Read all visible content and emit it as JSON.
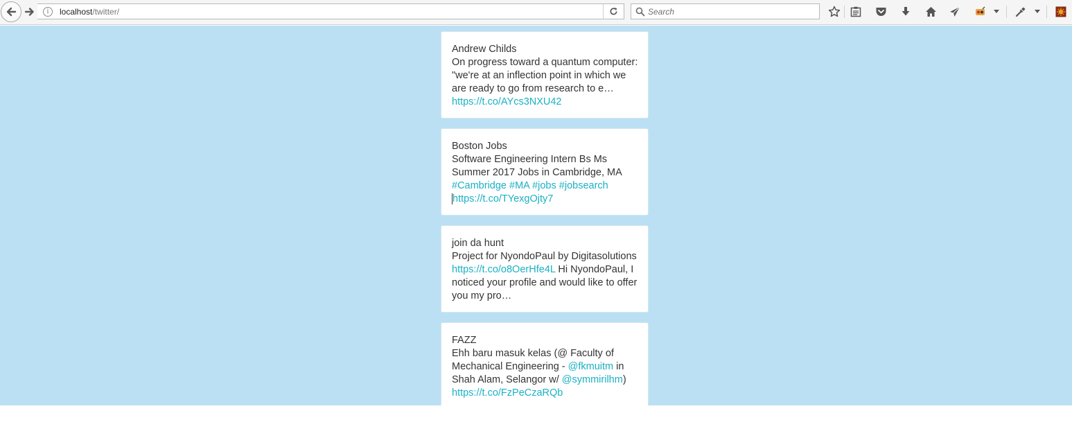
{
  "browser": {
    "url_host": "localhost",
    "url_path": "/twitter/",
    "search_placeholder": "Search"
  },
  "tweets": [
    {
      "author": "Andrew Childs",
      "parts": [
        {
          "t": "On progress toward a quantum computer: \"we're at an inflection point in which we are ready to go from research to e… "
        },
        {
          "t": "https://t.co/AYcs3NXU42",
          "link": true
        }
      ]
    },
    {
      "author": "Boston Jobs",
      "parts": [
        {
          "t": "Software Engineering Intern Bs Ms Summer 2017 Jobs in Cambridge, MA "
        },
        {
          "t": "#Cambridge",
          "link": true
        },
        {
          "t": " "
        },
        {
          "t": "#MA",
          "link": true
        },
        {
          "t": " "
        },
        {
          "t": "#jobs",
          "link": true
        },
        {
          "t": " "
        },
        {
          "t": "#jobsearch",
          "link": true
        },
        {
          "t": " "
        },
        {
          "t": "https://t.co/TYexgOjty7",
          "link": true,
          "caret": true
        }
      ]
    },
    {
      "author": "join da hunt",
      "parts": [
        {
          "t": "Project for NyondoPaul by Digitasolutions "
        },
        {
          "t": "https://t.co/o8OerHfe4L",
          "link": true
        },
        {
          "t": " Hi NyondoPaul, I noticed your profile and would like to offer you my pro…"
        }
      ]
    },
    {
      "author": "FAZZ",
      "parts": [
        {
          "t": "Ehh baru masuk kelas (@ Faculty of Mechanical Engineering - "
        },
        {
          "t": "@fkmuitm",
          "link": true
        },
        {
          "t": " in Shah Alam, Selangor w/ "
        },
        {
          "t": "@symmirilhm",
          "link": true
        },
        {
          "t": ") "
        },
        {
          "t": "https://t.co/FzPeCzaRQb",
          "link": true
        }
      ]
    }
  ],
  "colors": {
    "page_background": "#bbe0f4",
    "card_background": "#ffffff",
    "link": "#1ab1c4",
    "text": "#333333"
  },
  "icons": [
    "back-arrow-icon",
    "forward-arrow-icon",
    "info-icon",
    "reload-icon",
    "search-icon",
    "bookmark-star-icon",
    "reading-list-icon",
    "pocket-icon",
    "download-icon",
    "home-icon",
    "send-icon",
    "extension-icon",
    "eyedropper-icon",
    "addon-icon"
  ]
}
